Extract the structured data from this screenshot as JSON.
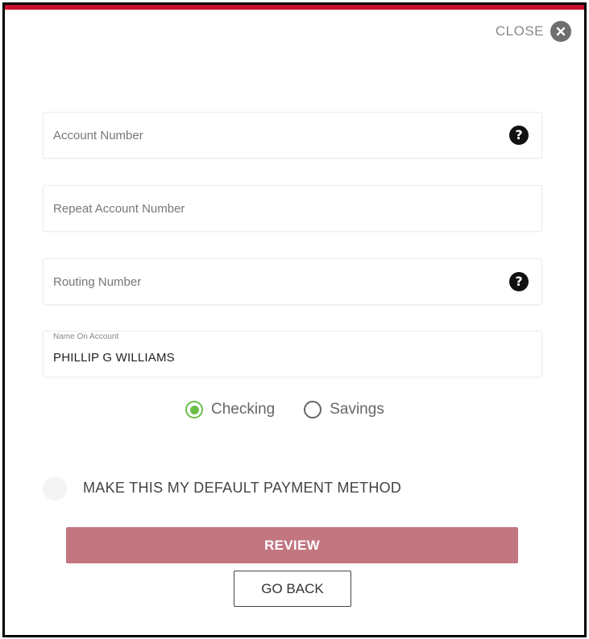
{
  "dialog": {
    "close_label": "CLOSE",
    "icons": {
      "close": "close-icon",
      "help": "question-circle-icon"
    },
    "accent_color": "#c8102e"
  },
  "form": {
    "account_number": {
      "placeholder": "Account Number",
      "value": "",
      "help": "?"
    },
    "repeat_account_number": {
      "placeholder": "Repeat Account Number",
      "value": ""
    },
    "routing_number": {
      "placeholder": "Routing Number",
      "value": "",
      "help": "?"
    },
    "name_on_account": {
      "label": "Name On Account",
      "value": "PHILLIP G WILLIAMS"
    },
    "account_type": {
      "options": [
        "Checking",
        "Savings"
      ],
      "selected": "Checking",
      "selected_color": "#6abf4b"
    },
    "default_payment": {
      "label": "MAKE THIS MY DEFAULT PAYMENT METHOD",
      "checked": false
    }
  },
  "actions": {
    "review_label": "REVIEW",
    "review_color": "#c17680",
    "go_back_label": "GO BACK"
  }
}
